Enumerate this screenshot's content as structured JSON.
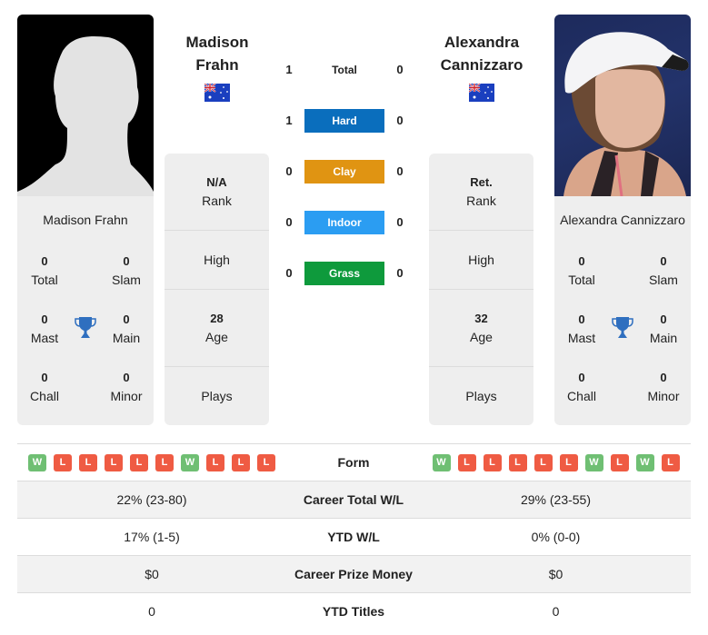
{
  "player1": {
    "name_line1": "Madison",
    "name_line2": "Frahn",
    "full_name": "Madison Frahn",
    "country_flag": "australia-flag",
    "photo": "silhouette-placeholder",
    "titles": {
      "total": {
        "value": "0",
        "label": "Total"
      },
      "slam": {
        "value": "0",
        "label": "Slam"
      },
      "mast": {
        "value": "0",
        "label": "Mast"
      },
      "main": {
        "value": "0",
        "label": "Main"
      },
      "chall": {
        "value": "0",
        "label": "Chall"
      },
      "minor": {
        "value": "0",
        "label": "Minor"
      }
    },
    "info": {
      "rank": {
        "value": "N/A",
        "label": "Rank"
      },
      "high": {
        "value": "",
        "label": "High"
      },
      "age": {
        "value": "28",
        "label": "Age"
      },
      "plays": {
        "value": "",
        "label": "Plays"
      }
    }
  },
  "player2": {
    "name_line1": "Alexandra",
    "name_line2": "Cannizzaro",
    "full_name": "Alexandra Cannizzaro",
    "country_flag": "australia-flag",
    "photo": "player-photo",
    "titles": {
      "total": {
        "value": "0",
        "label": "Total"
      },
      "slam": {
        "value": "0",
        "label": "Slam"
      },
      "mast": {
        "value": "0",
        "label": "Mast"
      },
      "main": {
        "value": "0",
        "label": "Main"
      },
      "chall": {
        "value": "0",
        "label": "Chall"
      },
      "minor": {
        "value": "0",
        "label": "Minor"
      }
    },
    "info": {
      "rank": {
        "value": "Ret.",
        "label": "Rank"
      },
      "high": {
        "value": "",
        "label": "High"
      },
      "age": {
        "value": "32",
        "label": "Age"
      },
      "plays": {
        "value": "",
        "label": "Plays"
      }
    }
  },
  "head_to_head": [
    {
      "surface": "Total",
      "p1": "1",
      "p2": "0",
      "color": ""
    },
    {
      "surface": "Hard",
      "p1": "1",
      "p2": "0",
      "color": "#0a6ebd"
    },
    {
      "surface": "Clay",
      "p1": "0",
      "p2": "0",
      "color": "#e09412"
    },
    {
      "surface": "Indoor",
      "p1": "0",
      "p2": "0",
      "color": "#2b9df2"
    },
    {
      "surface": "Grass",
      "p1": "0",
      "p2": "0",
      "color": "#0e9a3c"
    }
  ],
  "stats": {
    "form": {
      "label": "Form",
      "p1": [
        "W",
        "L",
        "L",
        "L",
        "L",
        "L",
        "W",
        "L",
        "L",
        "L"
      ],
      "p2": [
        "W",
        "L",
        "L",
        "L",
        "L",
        "L",
        "W",
        "L",
        "W",
        "L"
      ]
    },
    "rows": [
      {
        "label": "Career Total W/L",
        "p1": "22% (23-80)",
        "p2": "29% (23-55)"
      },
      {
        "label": "YTD W/L",
        "p1": "17% (1-5)",
        "p2": "0% (0-0)"
      },
      {
        "label": "Career Prize Money",
        "p1": "$0",
        "p2": "$0"
      },
      {
        "label": "YTD Titles",
        "p1": "0",
        "p2": "0"
      }
    ]
  },
  "colors": {
    "win": "#6fbf73",
    "loss": "#ef5b43",
    "trophy": "#2f6fbf",
    "card_bg": "#eeeeee"
  }
}
